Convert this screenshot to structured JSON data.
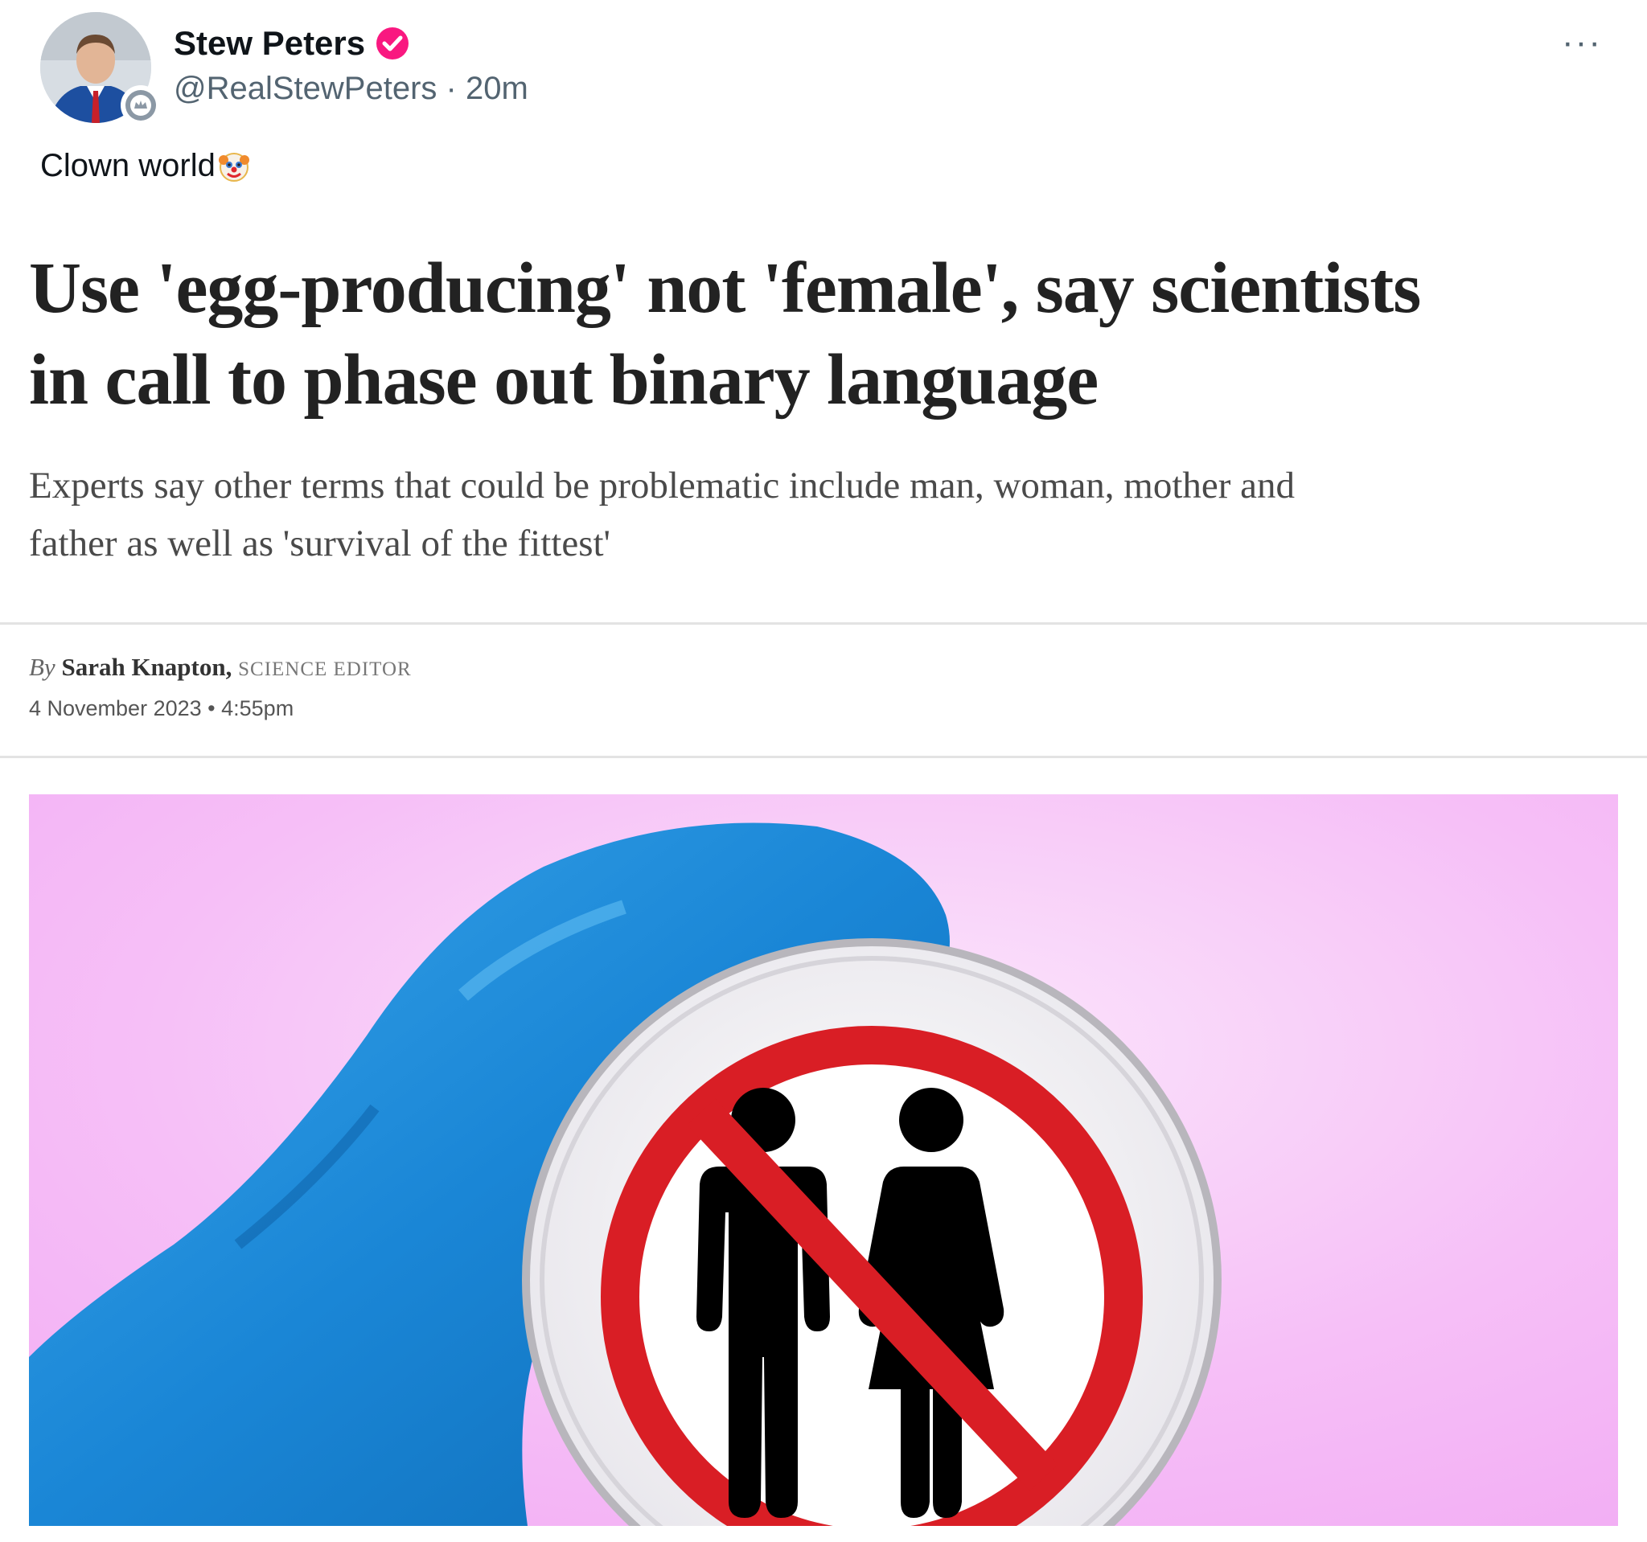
{
  "post": {
    "author_name": "Stew Peters",
    "handle": "@RealStewPeters",
    "separator": "·",
    "time": "20m",
    "more_label": "···",
    "text": "Clown world",
    "emoji": "clown-face-icon"
  },
  "article": {
    "headline_line1": "Use 'egg-producing' not 'female', say scientists",
    "headline_line2": "in call to phase out binary language",
    "standfirst_line1": "Experts say other terms that could be problematic include man, woman, mother and",
    "standfirst_line2": "father as well as 'survival of the fittest'",
    "by_label": "By",
    "author": "Sarah Knapton,",
    "author_role": "SCIENCE EDITOR",
    "date": "4 November 2023",
    "date_separator": "•",
    "time": "4:55pm"
  },
  "image": {
    "description_icon": "gloved-hand-petri-dish-prohibition-sign",
    "background_color": "#f4b3f6",
    "glove_color": "#1a8ad8",
    "sign_color": "#d91e25"
  },
  "colors": {
    "verified_badge": "#f91880",
    "text_primary": "#0f1419",
    "text_secondary": "#536471"
  }
}
